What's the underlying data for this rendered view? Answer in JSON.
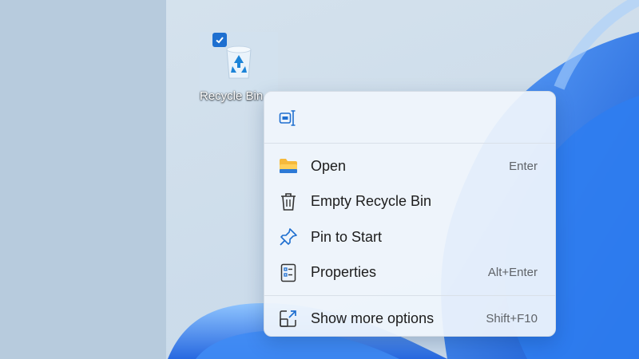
{
  "desktop": {
    "icon": {
      "label": "Recycle Bin",
      "selected": true
    }
  },
  "context_menu": {
    "quick_actions": [
      {
        "name": "rename",
        "icon": "rename-icon"
      }
    ],
    "items": [
      {
        "label": "Open",
        "shortcut": "Enter",
        "icon": "folder-icon"
      },
      {
        "label": "Empty Recycle Bin",
        "shortcut": "",
        "icon": "trash-icon"
      },
      {
        "label": "Pin to Start",
        "shortcut": "",
        "icon": "pin-icon"
      },
      {
        "label": "Properties",
        "shortcut": "Alt+Enter",
        "icon": "properties-icon"
      }
    ],
    "more": {
      "label": "Show more options",
      "shortcut": "Shift+F10",
      "icon": "show-more-icon"
    }
  },
  "colors": {
    "accent": "#1e6fd0",
    "wallpaper_blue": "#1f6fe0",
    "menu_background": "#f0f5fc"
  }
}
